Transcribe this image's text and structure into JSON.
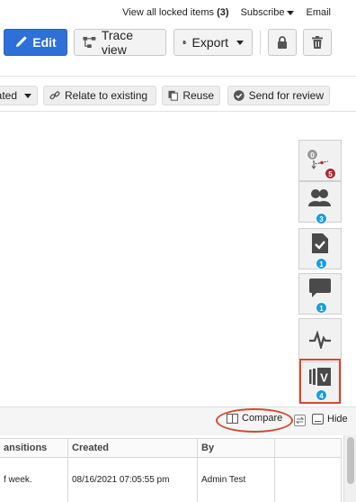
{
  "topnav": {
    "locked_label": "View all locked items",
    "locked_count": "(3)",
    "subscribe": "Subscribe",
    "email": "Email"
  },
  "toolbar": {
    "edit": "Edit",
    "trace_view": "Trace view",
    "export": "Export"
  },
  "actions": {
    "status": "ated",
    "relate": "Relate to existing",
    "reuse": "Reuse",
    "review": "Send for review"
  },
  "side_tabs": {
    "trace_gray_badge": "0",
    "trace_red_badge": "5",
    "users_badge": "3",
    "tasks_badge": "1",
    "comments_badge": "1",
    "versions_badge": "4",
    "version_letter": "V"
  },
  "bottom": {
    "compare": "Compare",
    "hide": "Hide"
  },
  "table": {
    "headers": [
      "ansitions",
      "Created",
      "By"
    ],
    "row": [
      "f week.",
      "08/16/2021 07:05:55 pm",
      "Admin Test"
    ]
  },
  "colors": {
    "primary": "#2e6fd8",
    "badge_blue": "#1a9be6",
    "badge_red": "#b52632",
    "highlight": "#d24a2e"
  }
}
